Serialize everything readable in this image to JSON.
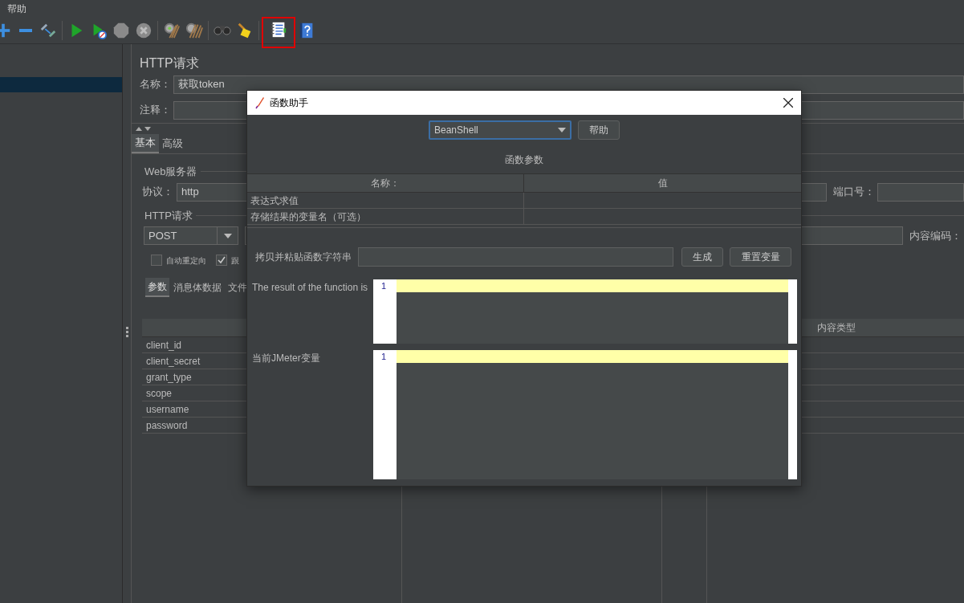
{
  "menu": [
    {
      "label": "帮助"
    }
  ],
  "toolbar": [
    [
      {
        "kind": "plus",
        "highlighted": false
      },
      {
        "kind": "minus",
        "highlighted": false
      },
      {
        "kind": "wand",
        "highlighted": false
      }
    ],
    [
      {
        "kind": "start",
        "highlighted": false
      },
      {
        "kind": "start-no-timer",
        "highlighted": false
      },
      {
        "kind": "stop",
        "highlighted": false
      },
      {
        "kind": "shutdown",
        "highlighted": false
      }
    ],
    [
      {
        "kind": "clear",
        "highlighted": false
      },
      {
        "kind": "clear-all",
        "highlighted": false
      }
    ],
    [
      {
        "kind": "search",
        "highlighted": false
      },
      {
        "kind": "reset-search",
        "highlighted": false
      }
    ],
    [
      {
        "kind": "function-helper",
        "highlighted": true
      },
      {
        "kind": "help",
        "highlighted": false
      }
    ]
  ],
  "tree": {
    "rows": [
      {
        "selected": true
      }
    ]
  },
  "sampler": {
    "title": "HTTP请求",
    "name_label": "名称：",
    "name_value": "获取token",
    "comment_label": "注释：",
    "tabs": [
      {
        "label": "基本",
        "selected": true
      },
      {
        "label": "高级",
        "selected": false
      }
    ],
    "web_server": {
      "group_label": "Web服务器",
      "protocol_label": "协议：",
      "protocol_value": "http",
      "port_label": "端口号："
    },
    "http_request": {
      "group_label": "HTTP请求",
      "method": "POST",
      "encoding_label": "内容编码：",
      "options": [
        {
          "label": "自动重定向",
          "checked": false
        },
        {
          "label": "跟",
          "checked": true
        }
      ]
    },
    "sub_tabs": [
      {
        "label": "参数",
        "selected": true
      },
      {
        "label": "消息体数据",
        "selected": false
      },
      {
        "label": "文件",
        "selected": false
      }
    ],
    "parameters": {
      "content_type_header": "内容类型",
      "rows": [
        {
          "name": "client_id"
        },
        {
          "name": "client_secret"
        },
        {
          "name": "grant_type"
        },
        {
          "name": "scope"
        },
        {
          "name": "username"
        },
        {
          "name": "password"
        }
      ]
    }
  },
  "dialog": {
    "title": "函数助手",
    "function": "BeanShell",
    "help_button": "帮助",
    "params_title": "函数参数",
    "params_columns": [
      "名称：",
      "值"
    ],
    "params_rows": [
      {
        "name": "表达式求值"
      },
      {
        "name": "存储结果的变量名（可选）"
      }
    ],
    "copy_label": "拷贝并粘贴函数字符串",
    "buttons": [
      "生成",
      "重置变量"
    ],
    "result_label": "The result of the function is",
    "result_lines": [
      "1"
    ],
    "variables_label": "当前JMeter变量",
    "variables_lines": [
      "1"
    ]
  }
}
